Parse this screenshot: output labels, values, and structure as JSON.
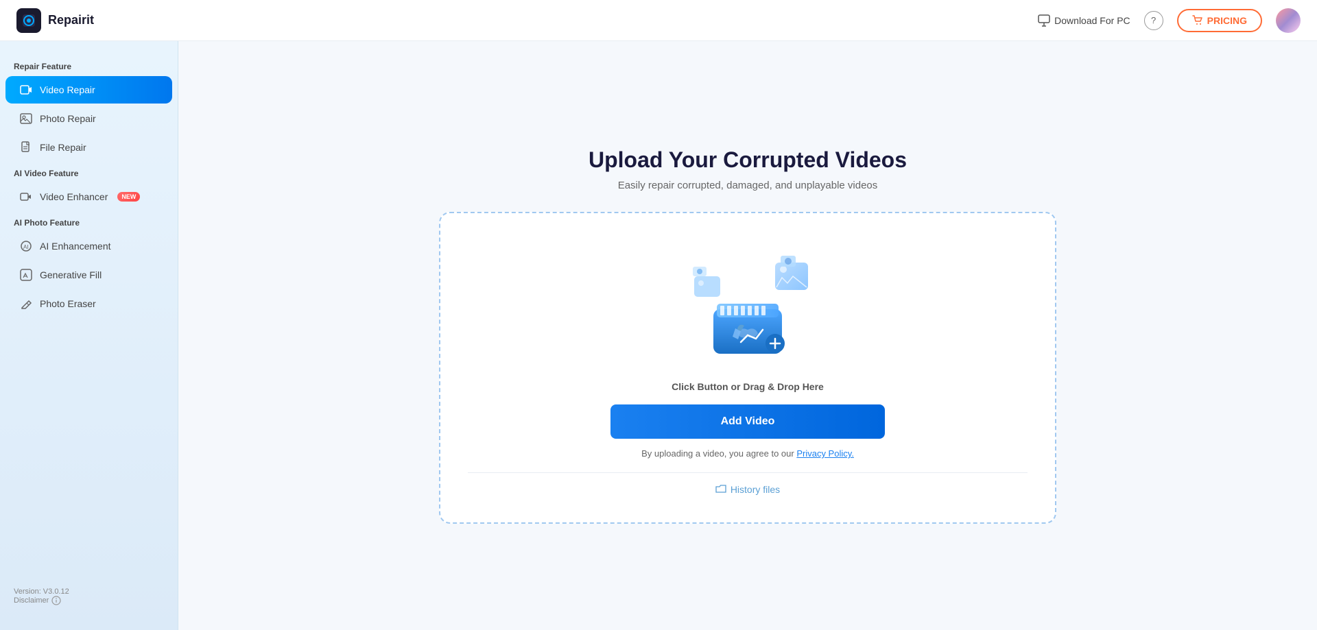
{
  "header": {
    "logo_icon": "R",
    "logo_text": "Repairit",
    "download_label": "Download For PC",
    "pricing_label": "PRICING"
  },
  "sidebar": {
    "repair_section": "Repair Feature",
    "ai_video_section": "AI Video Feature",
    "ai_photo_section": "AI Photo Feature",
    "items": [
      {
        "id": "video-repair",
        "label": "Video Repair",
        "active": true,
        "new": false
      },
      {
        "id": "photo-repair",
        "label": "Photo Repair",
        "active": false,
        "new": false
      },
      {
        "id": "file-repair",
        "label": "File Repair",
        "active": false,
        "new": false
      },
      {
        "id": "video-enhancer",
        "label": "Video Enhancer",
        "active": false,
        "new": true
      },
      {
        "id": "ai-enhancement",
        "label": "AI Enhancement",
        "active": false,
        "new": false
      },
      {
        "id": "generative-fill",
        "label": "Generative Fill",
        "active": false,
        "new": false
      },
      {
        "id": "photo-eraser",
        "label": "Photo Eraser",
        "active": false,
        "new": false
      }
    ],
    "version_label": "Version: V3.0.12",
    "disclaimer_label": "Disclaimer"
  },
  "main": {
    "title": "Upload Your Corrupted Videos",
    "subtitle": "Easily repair corrupted, damaged, and unplayable videos",
    "drop_text": "Click Button or Drag & Drop Here",
    "add_video_label": "Add Video",
    "privacy_text_before": "By uploading a video, you agree to our ",
    "privacy_link": "Privacy Policy.",
    "history_label": "History files",
    "new_badge": "NEW"
  }
}
